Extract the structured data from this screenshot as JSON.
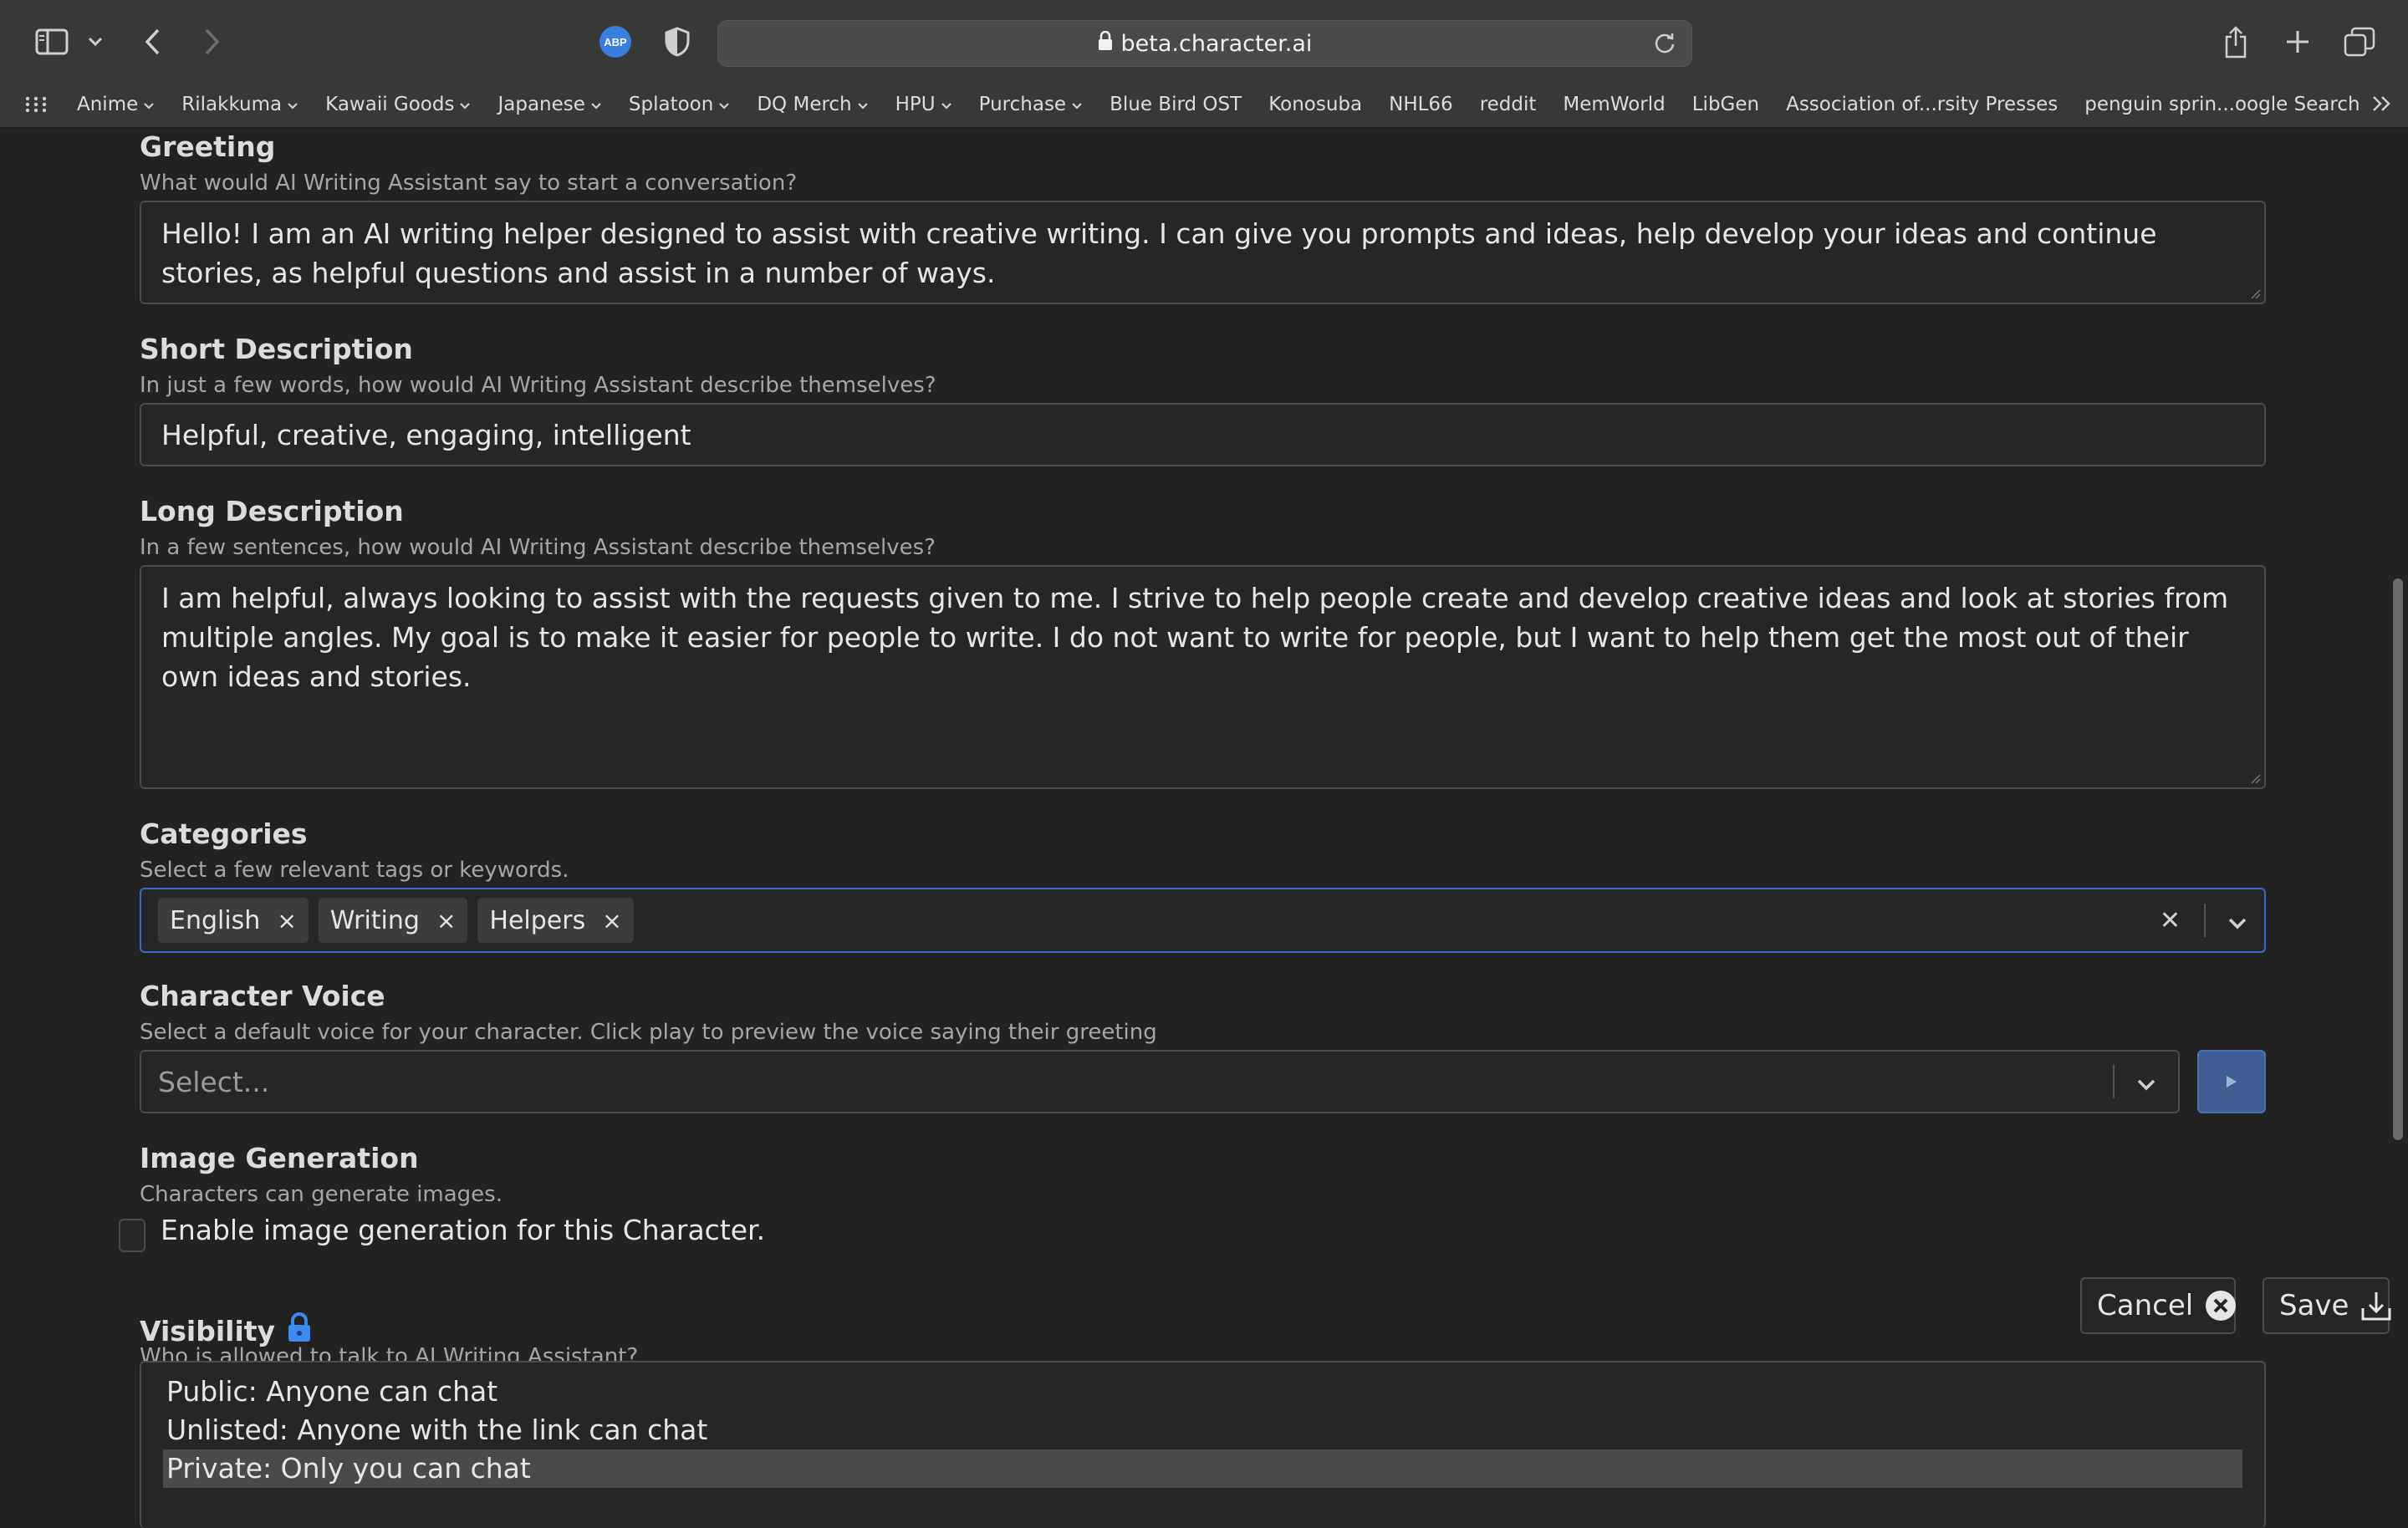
{
  "browser": {
    "url": "beta.character.ai",
    "bookmarks": [
      {
        "label": "Anime",
        "folder": true
      },
      {
        "label": "Rilakkuma",
        "folder": true
      },
      {
        "label": "Kawaii Goods",
        "folder": true
      },
      {
        "label": "Japanese",
        "folder": true
      },
      {
        "label": "Splatoon",
        "folder": true
      },
      {
        "label": "DQ Merch",
        "folder": true
      },
      {
        "label": "HPU",
        "folder": true
      },
      {
        "label": "Purchase",
        "folder": true
      },
      {
        "label": "Blue Bird OST",
        "folder": false
      },
      {
        "label": "Konosuba",
        "folder": false
      },
      {
        "label": "NHL66",
        "folder": false
      },
      {
        "label": "reddit",
        "folder": false
      },
      {
        "label": "MemWorld",
        "folder": false
      },
      {
        "label": "LibGen",
        "folder": false
      },
      {
        "label": "Association of...rsity Presses",
        "folder": false
      },
      {
        "label": "penguin sprin...oogle Search",
        "folder": false
      }
    ],
    "icons": {
      "sidebar": "sidebar-icon",
      "back": "chevron-left-icon",
      "forward": "chevron-right-icon",
      "adblock": "abp-icon",
      "privacy": "shield-icon",
      "share": "share-icon",
      "new_tab": "plus-icon",
      "tabs": "tabs-overview-icon"
    },
    "adblock_badge": "ABP"
  },
  "form": {
    "greeting": {
      "label": "Greeting",
      "hint": "What would AI Writing Assistant say to start a conversation?",
      "value": "Hello! I am an AI writing helper designed to assist with creative writing. I can give you prompts and ideas, help develop your ideas and continue stories, as helpful questions and assist in a number of ways."
    },
    "short_description": {
      "label": "Short Description",
      "hint": "In just a few words, how would AI Writing Assistant describe themselves?",
      "value": "Helpful, creative, engaging, intelligent"
    },
    "long_description": {
      "label": "Long Description",
      "hint": "In a few sentences, how would AI Writing Assistant describe themselves?",
      "value": "I am helpful, always looking to assist with the requests given to me. I strive to help people create and develop creative ideas and look at stories from multiple angles. My goal is to make it easier for people to write. I do not want to write for people, but I want to help them get the most out of their own ideas and stories."
    },
    "categories": {
      "label": "Categories",
      "hint": "Select a few relevant tags or keywords.",
      "tags": [
        "English",
        "Writing",
        "Helpers"
      ],
      "remove_glyph": "×",
      "clear_glyph": "✕"
    },
    "voice": {
      "label": "Character Voice",
      "hint": "Select a default voice for your character. Click play to preview the voice saying their greeting",
      "placeholder": "Select..."
    },
    "image_generation": {
      "label": "Image Generation",
      "hint": "Characters can generate images.",
      "checkbox_label": "Enable image generation for this Character.",
      "checked": false
    },
    "visibility": {
      "label": "Visibility",
      "hint": "Who is allowed to talk to AI Writing Assistant?",
      "options": [
        "Public: Anyone can chat",
        "Unlisted: Anyone with the link can chat",
        "Private: Only you can chat"
      ],
      "selected_index": 2
    }
  },
  "actions": {
    "cancel": "Cancel",
    "save": "Save"
  },
  "colors": {
    "page_bg": "#222222",
    "focus_border": "#3b6cc4",
    "play_button": "#3d5f94",
    "lock_icon": "#3d8bf2",
    "selected_option_bg": "#4a4a4a"
  }
}
